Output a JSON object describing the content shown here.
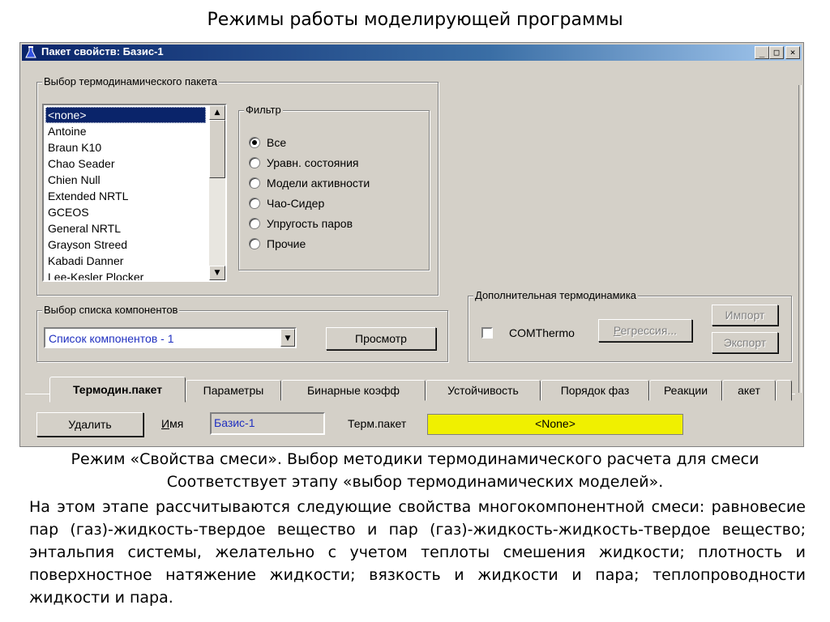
{
  "slide": {
    "title": "Режимы работы моделирующей программы",
    "caption_line1": "Режим «Свойства смеси». Выбор методики термодинамического расчета для смеси",
    "caption_line2": "Соответствует этапу «выбор термодинамических моделей».",
    "body": "На этом этапе рассчитываются следующие свойства многокомпонентной смеси: равновесие пар (газ)-жидкость-твердое вещество и пар (газ)-жидкость-жидкость-твердое вещество; энтальпия системы, желательно с учетом теплоты смешения жидкости; плотность и поверхностное натяжение жидкости; вязкость и жидкости и пара; теплопроводности жидкости и пара."
  },
  "window": {
    "title": "Пакет свойств: Базис-1",
    "minimize": "_",
    "maximize": "□",
    "close": "×"
  },
  "thermo_group": {
    "title": "Выбор термодинамического пакета",
    "packages": [
      "<none>",
      "Antoine",
      "Braun K10",
      "Chao Seader",
      "Chien Null",
      "Extended NRTL",
      "GCEOS",
      "General NRTL",
      "Grayson Streed",
      "Kabadi Danner",
      "Lee-Kesler Plocker"
    ],
    "selected_index": 0,
    "filter": {
      "title": "Фильтр",
      "options": [
        "Все",
        "Уравн. состояния",
        "Модели активности",
        "Чао-Сидер",
        "Упругость паров",
        "Прочие"
      ],
      "selected_index": 0
    }
  },
  "components_group": {
    "title": "Выбор списка компонентов",
    "selected": "Список компонентов - 1",
    "view_button": "Просмотр"
  },
  "extra_group": {
    "title": "Дополнительная термодинамика",
    "comthermo_label": "COMThermo",
    "regression_button": "Регрессия...",
    "import_button": "Импорт",
    "export_button": "Экспорт"
  },
  "tabs": [
    "Термодин.пакет",
    "Параметры",
    "Бинарные коэфф",
    "Устойчивость",
    "Порядок фаз",
    "Реакции",
    "акет"
  ],
  "active_tab": 0,
  "footer": {
    "delete_button": "Удалить",
    "name_label": "Имя",
    "name_value": "Базис-1",
    "package_label": "Терм.пакет",
    "package_value": "<None>"
  },
  "colors": {
    "titlebar": "#0a246a",
    "selection": "#0a246a",
    "package_highlight": "#f0f000",
    "dialog_face": "#d4d0c8"
  }
}
